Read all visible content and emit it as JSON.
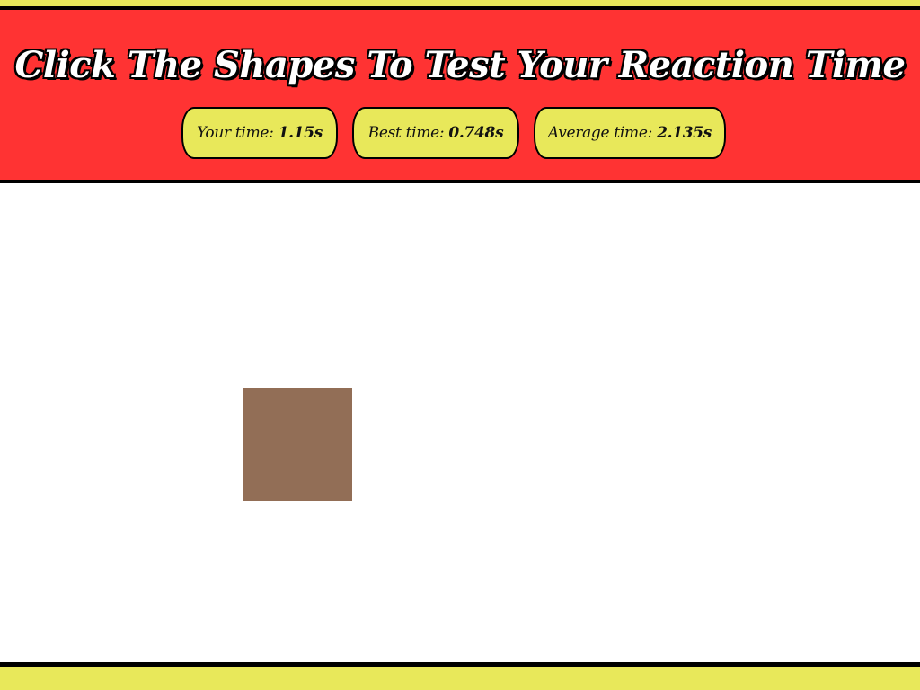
{
  "header": {
    "title": "Click The Shapes To Test Your Reaction Time"
  },
  "stats": {
    "your_time": {
      "label": "Your time:",
      "value": "1.15s"
    },
    "best_time": {
      "label": "Best time:",
      "value": "0.748s"
    },
    "average_time": {
      "label": "Average time:",
      "value": "2.135s"
    }
  },
  "shape": {
    "type": "square",
    "color": "#926e56"
  },
  "colors": {
    "header_bg": "#ff3333",
    "accent_yellow": "#e8e85a",
    "border": "#000000"
  }
}
